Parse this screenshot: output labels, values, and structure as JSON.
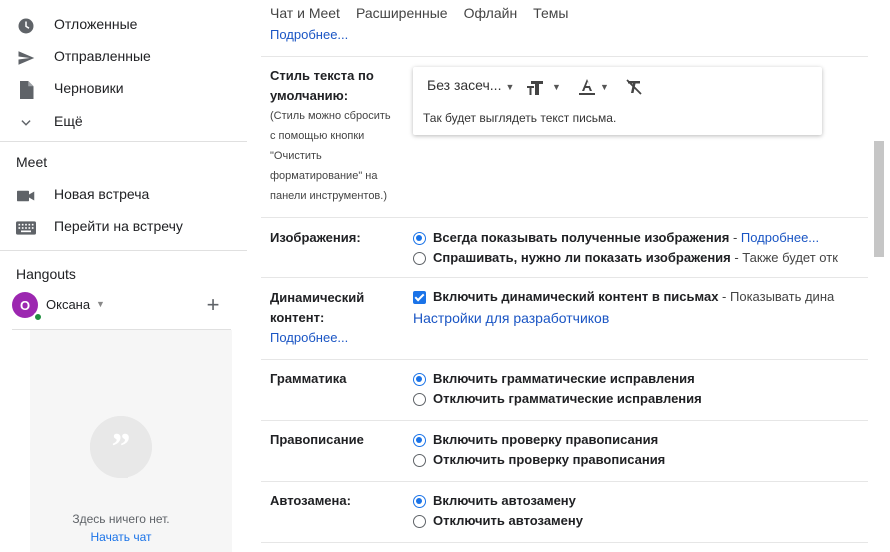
{
  "sidebar": {
    "items": [
      {
        "label": "Отложенные",
        "icon": "clock-icon"
      },
      {
        "label": "Отправленные",
        "icon": "send-icon"
      },
      {
        "label": "Черновики",
        "icon": "draft-file-icon"
      },
      {
        "label": "Ещё",
        "icon": "chevron-down-icon"
      }
    ],
    "meet": {
      "title": "Meet",
      "items": [
        {
          "label": "Новая встреча",
          "icon": "video-camera-icon"
        },
        {
          "label": "Перейти на встречу",
          "icon": "keyboard-icon"
        }
      ]
    },
    "hangouts": {
      "title": "Hangouts",
      "user": {
        "initial": "O",
        "name": "Оксана",
        "avatar_color": "#9c27b0",
        "status_color": "#1e8e3e"
      },
      "empty_text": "Здесь ничего нет.",
      "start_chat": "Начать чат"
    }
  },
  "tabs": [
    "Чат и Meet",
    "Расширенные",
    "Офлайн",
    "Темы"
  ],
  "settings": {
    "top_link": "Подробнее...",
    "text_style": {
      "label_line1": "Стиль текста по",
      "label_line2": "умолчанию:",
      "hint": [
        "(Стиль можно сбросить",
        "с помощью кнопки",
        "\"Очистить",
        "форматирование\" на",
        "панели инструментов.)"
      ],
      "font": "Без засеч...",
      "preview": "Так будет выглядеть текст письма."
    },
    "images": {
      "label": "Изображения:",
      "opt1": "Всегда показывать полученные изображения",
      "opt1_sep": " - ",
      "opt1_link": "Подробнее...",
      "opt2": "Спрашивать, нужно ли показать изображения",
      "opt2_desc": " - Также будет отк"
    },
    "dynamic": {
      "label_line1": "Динамический",
      "label_line2": "контент:",
      "link": "Подробнее...",
      "opt": "Включить динамический контент в письмах",
      "opt_desc": " - Показывать дина",
      "dev_link": "Настройки для разработчиков"
    },
    "grammar": {
      "label": "Грамматика",
      "opt1": "Включить грамматические исправления",
      "opt2": "Отключить грамматические исправления"
    },
    "spelling": {
      "label": "Правописание",
      "opt1": "Включить проверку правописания",
      "opt2": "Отключить проверку правописания"
    },
    "autocorrect": {
      "label": "Автозамена:",
      "opt1": "Включить автозамену",
      "opt2": "Отключить автозамену"
    }
  },
  "colors": {
    "accent": "#1a73e8",
    "link": "#1a55c4"
  }
}
